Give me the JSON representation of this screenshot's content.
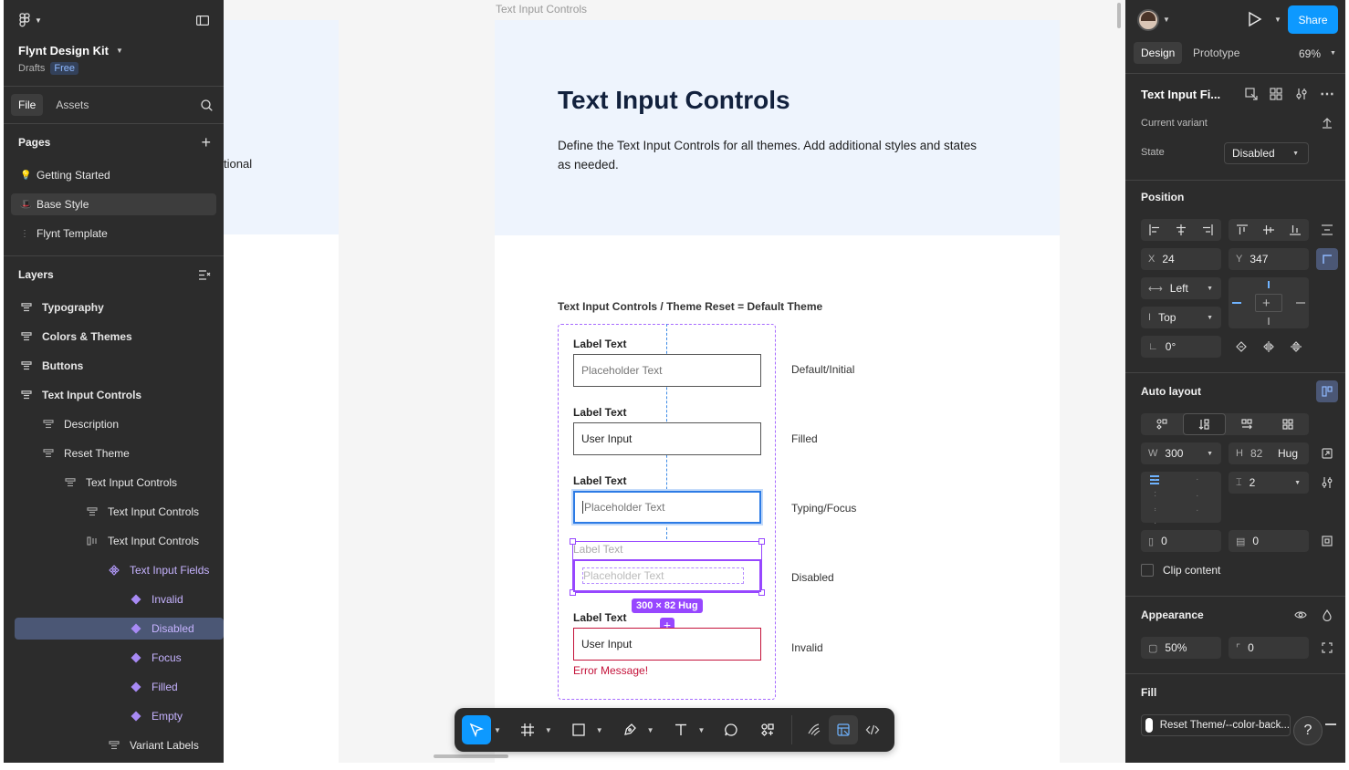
{
  "left_panel": {
    "file_name": "Flynt Design Kit",
    "location": "Drafts",
    "plan_badge": "Free",
    "tabs": [
      "File",
      "Assets"
    ],
    "pages_heading": "Pages",
    "pages": [
      {
        "emoji": "💡",
        "label": "Getting Started"
      },
      {
        "emoji": "🎩",
        "label": "Base Style"
      },
      {
        "emoji": "⋮",
        "label": "Flynt Template"
      }
    ],
    "layers_heading": "Layers",
    "layers": [
      {
        "label": "Typography"
      },
      {
        "label": "Colors & Themes"
      },
      {
        "label": "Buttons"
      },
      {
        "label": "Text Input Controls"
      },
      {
        "label": "Description"
      },
      {
        "label": "Reset Theme"
      },
      {
        "label": "Text Input Controls"
      },
      {
        "label": "Text Input Controls"
      },
      {
        "label": "Text Input Controls"
      },
      {
        "label": "Text Input Fields"
      },
      {
        "label": "Invalid"
      },
      {
        "label": "Disabled"
      },
      {
        "label": "Focus"
      },
      {
        "label": "Filled"
      },
      {
        "label": "Empty"
      },
      {
        "label": "Variant Labels"
      }
    ]
  },
  "canvas": {
    "frame_name": "Text Input Controls",
    "partial_text": "tional",
    "heading": "Text Input Controls",
    "description": "Define the Text Input Controls for all themes. Add additional styles and states as needed.",
    "section_title": "Text Input Controls / Theme Reset = Default Theme",
    "inputs": [
      {
        "label": "Label Text",
        "value": "Placeholder Text",
        "state": "Default/Initial"
      },
      {
        "label": "Label Text",
        "value": "User Input",
        "state": "Filled"
      },
      {
        "label": "Label Text",
        "value": "Placeholder Text",
        "state": "Typing/Focus"
      },
      {
        "label": "Label Text",
        "value": "Placeholder Text",
        "state": "Disabled"
      },
      {
        "label": "Label Text",
        "value": "User Input",
        "state": "Invalid"
      }
    ],
    "error_message": "Error Message!",
    "size_badge": "300 × 82 Hug"
  },
  "right_panel": {
    "share_label": "Share",
    "tabs": [
      "Design",
      "Prototype"
    ],
    "zoom": "69%",
    "component_name": "Text Input Fi...",
    "current_variant_label": "Current variant",
    "state_label": "State",
    "state_value": "Disabled",
    "position_heading": "Position",
    "x_label": "X",
    "x_value": "24",
    "y_label": "Y",
    "y_value": "347",
    "h_constraint": "Left",
    "v_constraint": "Top",
    "rotation": "0°",
    "auto_layout_heading": "Auto layout",
    "w_label": "W",
    "w_value": "300",
    "h_label": "H",
    "h_value": "82",
    "h_mode": "Hug",
    "gap_value": "2",
    "pad_h": "0",
    "pad_v": "0",
    "clip_content": "Clip content",
    "appearance_heading": "Appearance",
    "opacity": "50%",
    "radius": "0",
    "fill_heading": "Fill",
    "fill_value": "Reset Theme/--color-back..."
  },
  "colors": {
    "accent": "#0d99ff",
    "component": "#9747ff",
    "error": "#c4123a",
    "selected_layer": "#4b5775"
  }
}
